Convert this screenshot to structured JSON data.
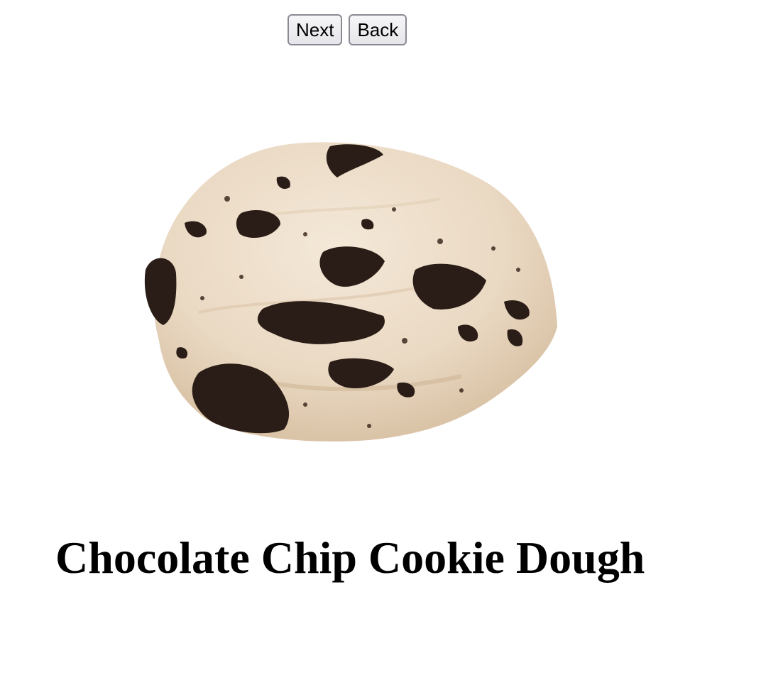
{
  "nav": {
    "next_label": "Next",
    "back_label": "Back"
  },
  "product": {
    "title": "Chocolate Chip Cookie Dough",
    "image_icon": "ice-cream-scoop-image",
    "colors": {
      "cream": "#ead9c3",
      "cream_shade": "#d9c2a6",
      "chunk": "#2a1c16"
    }
  }
}
